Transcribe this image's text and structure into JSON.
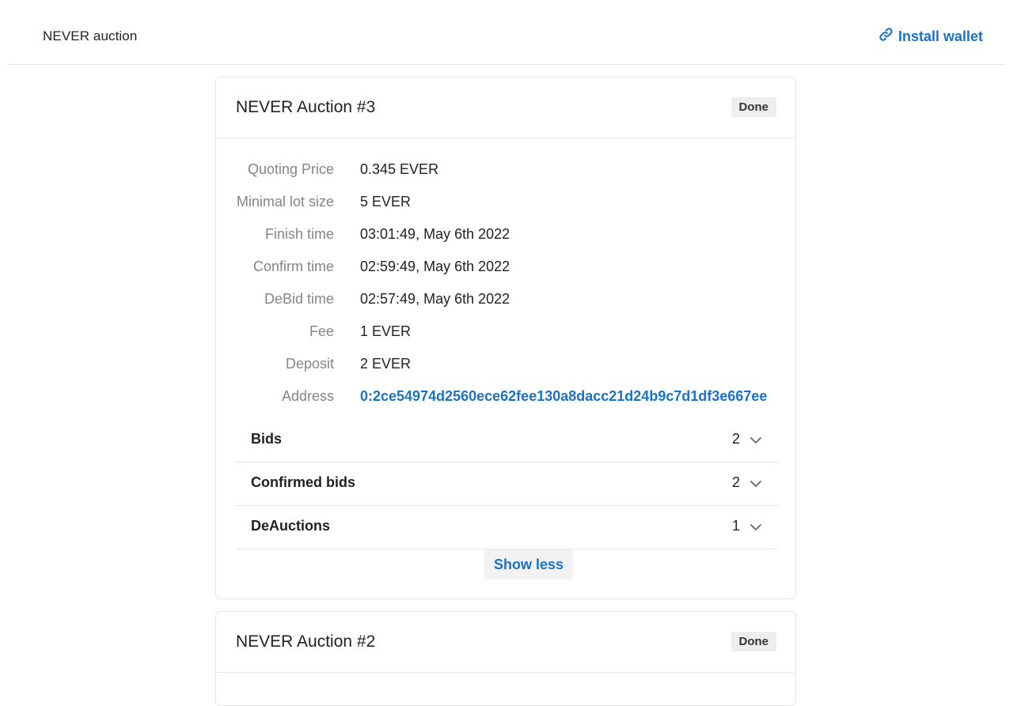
{
  "header": {
    "brand": "NEVER auction",
    "wallet_label": "Install wallet",
    "accent": "#1a73c8"
  },
  "auctions": [
    {
      "title": "NEVER Auction #3",
      "status": "Done",
      "fields": [
        {
          "label": "Quoting Price",
          "value": "0.345 EVER"
        },
        {
          "label": "Minimal lot size",
          "value": "5 EVER"
        },
        {
          "label": "Finish time",
          "value": "03:01:49, May 6th 2022"
        },
        {
          "label": "Confirm time",
          "value": "02:59:49, May 6th 2022"
        },
        {
          "label": "DeBid time",
          "value": "02:57:49, May 6th 2022"
        },
        {
          "label": "Fee",
          "value": "1 EVER"
        },
        {
          "label": "Deposit",
          "value": "2 EVER"
        },
        {
          "label": "Address",
          "value": "0:2ce54974d2560ece62fee130a8dacc21d24b9c7d1df3e667ee"
        }
      ],
      "sections": [
        {
          "label": "Bids",
          "count": "2"
        },
        {
          "label": "Confirmed bids",
          "count": "2"
        },
        {
          "label": "DeAuctions",
          "count": "1"
        }
      ],
      "toggle_label": "Show less"
    },
    {
      "title": "NEVER Auction #2",
      "status": "Done"
    }
  ]
}
